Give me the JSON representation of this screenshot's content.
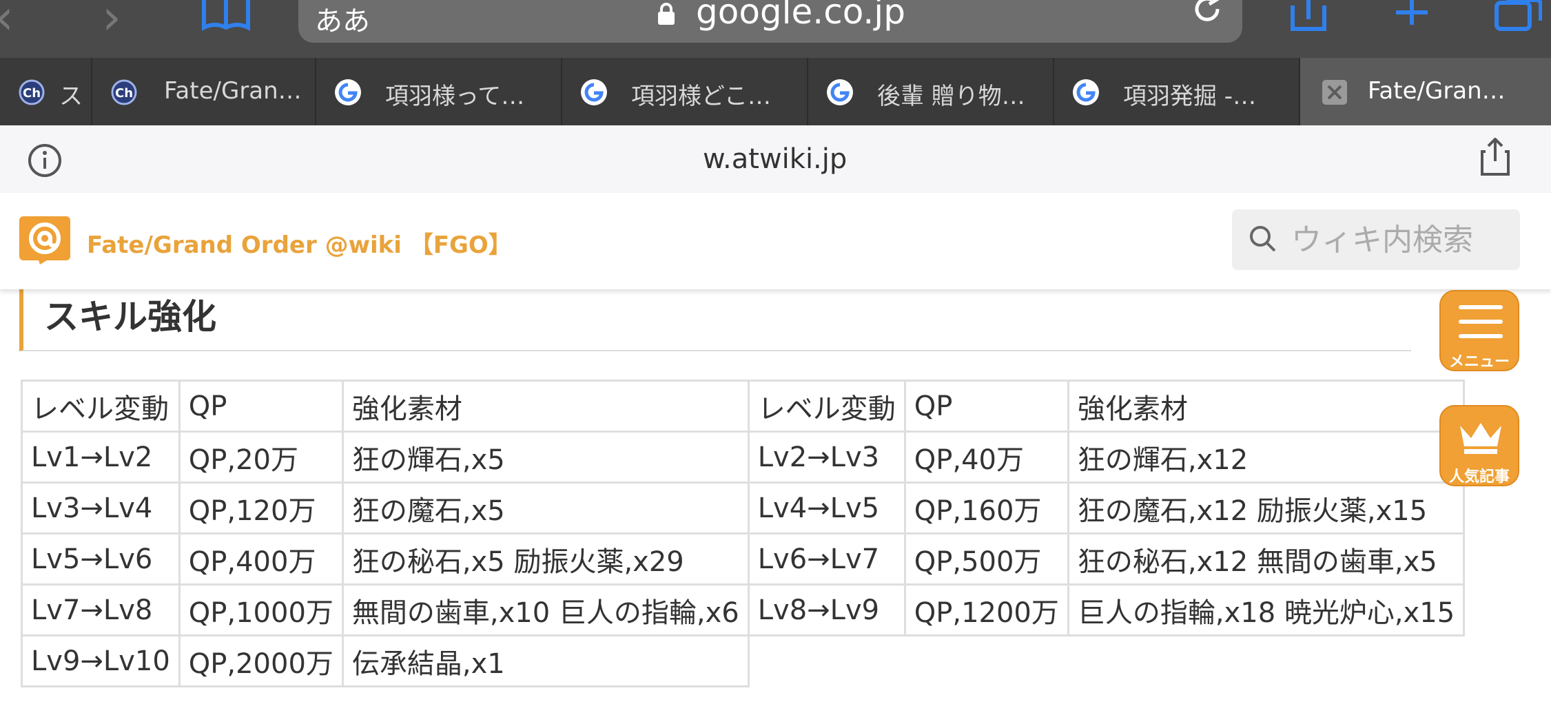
{
  "browser": {
    "address_prefix": "ああ",
    "address_host": "google.co.jp",
    "page_host": "w.atwiki.jp",
    "tabs": [
      {
        "favicon": "ch-icon",
        "title": "ス"
      },
      {
        "favicon": "ch-icon",
        "title": "Fate/Gran…"
      },
      {
        "favicon": "google-icon",
        "title": "項羽様って…"
      },
      {
        "favicon": "google-icon",
        "title": "項羽様どこ…"
      },
      {
        "favicon": "google-icon",
        "title": "後輩 贈り物…"
      },
      {
        "favicon": "google-icon",
        "title": "項羽発掘 -…"
      },
      {
        "favicon": "close-icon",
        "title": "Fate/Gran…"
      }
    ]
  },
  "site": {
    "title": "Fate/Grand Order @wiki 【FGO】",
    "search_placeholder": "ウィキ内検索",
    "brand_color": "#e9a33b"
  },
  "content": {
    "heading": "スキル強化",
    "table": {
      "headers": [
        "レベル変動",
        "QP",
        "強化素材",
        "レベル変動",
        "QP",
        "強化素材"
      ],
      "rows": [
        [
          "Lv1→Lv2",
          "QP,20万",
          "狂の輝石,x5",
          "Lv2→Lv3",
          "QP,40万",
          "狂の輝石,x12"
        ],
        [
          "Lv3→Lv4",
          "QP,120万",
          "狂の魔石,x5",
          "Lv4→Lv5",
          "QP,160万",
          "狂の魔石,x12 励振火薬,x15"
        ],
        [
          "Lv5→Lv6",
          "QP,400万",
          "狂の秘石,x5 励振火薬,x29",
          "Lv6→Lv7",
          "QP,500万",
          "狂の秘石,x12 無間の歯車,x5"
        ],
        [
          "Lv7→Lv8",
          "QP,1000万",
          "無間の歯車,x10 巨人の指輪,x6",
          "Lv8→Lv9",
          "QP,1200万",
          "巨人の指輪,x18 暁光炉心,x15"
        ],
        [
          "Lv9→Lv10",
          "QP,2000万",
          "伝承結晶,x1",
          "",
          "",
          ""
        ]
      ]
    }
  },
  "floating": {
    "menu_label": "メニュー",
    "popular_label": "人気記事",
    "button_color": "#f0a034"
  }
}
